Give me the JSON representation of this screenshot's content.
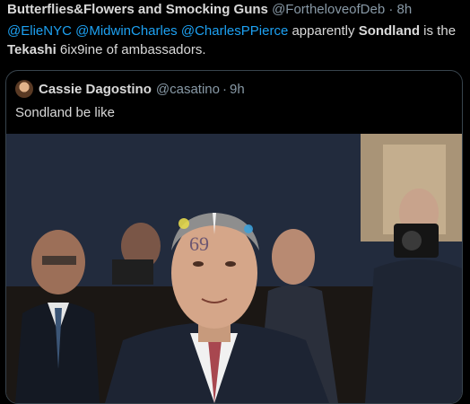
{
  "tweet": {
    "author_name": "Butterflies&Flowers and Smocking Guns",
    "author_handle": "@FortheloveofDeb",
    "separator": "·",
    "time": "8h",
    "mentions": [
      "@ElieNYC",
      "@MidwinCharles",
      "@CharlesPPierce"
    ],
    "text_part1": " apparently ",
    "bold_word_1": "Sondland",
    "text_part2": " is the",
    "bold_word_2": "Tekashi",
    "text_part3": " 6ix9ine of ambassadors."
  },
  "quoted_tweet": {
    "author_name": "Cassie Dagostino",
    "author_handle": "@casatino",
    "separator": "·",
    "time": "9h",
    "text": "Sondland be like",
    "image_icon": "photo-meme",
    "face_tattoo_text": "69"
  },
  "colors": {
    "background": "#000000",
    "text": "#d9d9d9",
    "muted": "#8899a6",
    "link": "#1da1f2",
    "border": "#38444d"
  }
}
